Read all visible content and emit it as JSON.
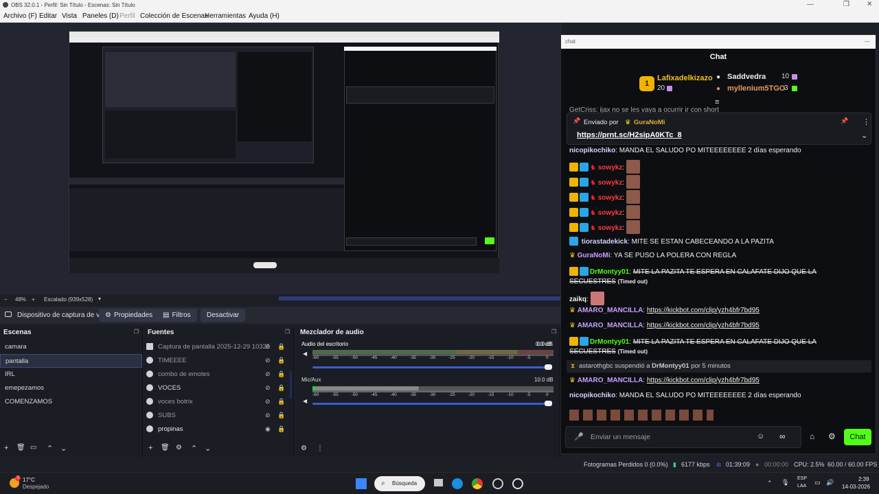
{
  "window": {
    "title": "OBS 32.0.1 - Perfil: Sin Título - Escenas: Sin Título"
  },
  "menu": [
    "Archivo (F)",
    "Editar",
    "Vista",
    "Paneles (D)",
    "Perfil",
    "Colección de Escenas",
    "Herramientas",
    "Ayuda (H)"
  ],
  "zoom": {
    "level": "48%",
    "scaling": "Escalado (939x528)"
  },
  "toolbar": {
    "source": "Dispositivo de captura de v",
    "properties": "Propiedades",
    "filters": "Filtros",
    "deactivate": "Desactivar"
  },
  "scenes": {
    "title": "Escenas",
    "items": [
      "camara",
      "pantalla",
      "IRL",
      "emepezamos",
      "COMENZAMOS"
    ],
    "selected": "pantalla"
  },
  "sources": {
    "title": "Fuentes",
    "items": [
      "Captura de pantalla 2025-12-29 10325",
      "TIMEEEE",
      "combo de emotes",
      "VOCES",
      "voces botrix",
      "SUBS",
      "propinas"
    ]
  },
  "mixer": {
    "title": "Mezclador de audio",
    "channels": [
      {
        "name": "Audio del escritorio",
        "db": "0.0 dB",
        "level": 0.0
      },
      {
        "name": "Mic/Aux",
        "db": "10.0 dB",
        "level": 0.0
      }
    ],
    "scale": [
      "-60",
      "-55",
      "-50",
      "-45",
      "-40",
      "-35",
      "-30",
      "-25",
      "-20",
      "-15",
      "-10",
      "-5",
      "0"
    ]
  },
  "status": {
    "dropped": "Fotogramas Perdidos 0 (0.0%)",
    "bitrate": "6177 kbps",
    "stream_time": "01:39:09",
    "rec_time": "00:00:00",
    "cpu": "CPU: 2.5%",
    "fps": "60.00 / 60.00 FPS"
  },
  "taskbar": {
    "weather_temp": "17°C",
    "weather_desc": "Despejado",
    "weather_badge": "3",
    "search": "Búsqueda",
    "lang": "ESP",
    "lang2": "LAA",
    "time": "2:39",
    "date": "14-03-2026"
  },
  "chat": {
    "tab": "chat",
    "title": "Chat",
    "top": [
      {
        "name": "Lafixadelkizazo",
        "count": "20"
      },
      {
        "name": "Saddvedra",
        "count": "10"
      },
      {
        "name": "myllenium5TGO",
        "count": "3"
      }
    ],
    "pinned": {
      "by_label": "Enviado por",
      "by_user": "GuraNoMi",
      "link": "https://prnt.sc/H2sipA0KTc_8"
    },
    "partial_top": "GetCriss: ijax no se les vaya a ocurrir ir con short",
    "messages": [
      {
        "user": "nicopikochiko",
        "text": "MANDA EL SALUDO PO MITEEEEEEEE 2 días esperando"
      },
      {
        "user": "sowykz",
        "text": ""
      },
      {
        "user": "sowykz",
        "text": ""
      },
      {
        "user": "sowykz",
        "text": ""
      },
      {
        "user": "sowykz",
        "text": ""
      },
      {
        "user": "sowykz",
        "text": ""
      },
      {
        "user": "tiorastadekick",
        "text": "MITE SE ESTAN CABECEANDO A LA PAZITA"
      },
      {
        "user": "GuraNoMi",
        "text": "YA SE PUSO LA POLERA CON REGLA"
      },
      {
        "user": "DrMontyy01",
        "text": "MITE LA PAZITA TE ESPERA EN CALAFATE DIJO QUE LA",
        "text2": "SECUESTRES",
        "note": "(Timed out)"
      },
      {
        "user": "zaikq",
        "text": ""
      },
      {
        "user": "AMARO_MANCILLA",
        "text": "https://kickbot.com/clip/yzh4bfr7bd95"
      },
      {
        "user": "AMARO_MANCILLA",
        "text": "https://kickbot.com/clip/yzh4bfr7bd95"
      },
      {
        "user": "DrMontyy01",
        "text": "MITE LA PAZITA TE ESPERA EN CALAFATE DIJO QUE LA",
        "text2": "SECUESTRES",
        "note": "(Timed out)"
      },
      {
        "user": "AMARO_MANCILLA",
        "text": "https://kickbot.com/clip/yzh4bfr7bd95"
      },
      {
        "user": "nicopikochiko",
        "text": "MANDA EL SALUDO PO MITEEEEEEEE 2 días esperando"
      }
    ],
    "mod_event": {
      "mod": "astarothgbc",
      "action": "suspendió a",
      "target": "DrMontyy01",
      "duration": "por 5 minutos"
    },
    "input_placeholder": "Enviar un mensaje",
    "send": "Chat"
  }
}
